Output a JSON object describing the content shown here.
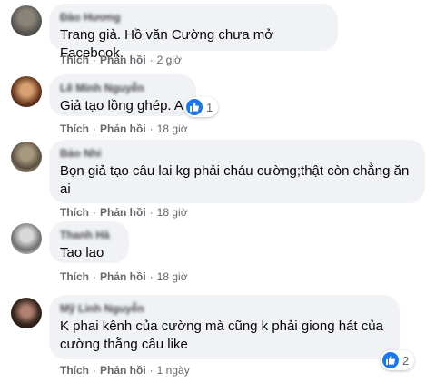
{
  "labels": {
    "like": "Thích",
    "reply": "Phản hồi",
    "separator": "·"
  },
  "comments": [
    {
      "author": "Đào Hương",
      "text": "Trang giả. Hồ văn Cường chưa mở Facebook.",
      "time": "2 giờ",
      "reactions": null
    },
    {
      "author": "Lê Minh Nguyễn",
      "text": "Giả tạo lồng ghép. A",
      "time": "18 giờ",
      "reactions": "1"
    },
    {
      "author": "Bảo Nhi",
      "text": "Bọn giả tạo câu lai kg phải cháu cường;thật còn chẳng ăn ai",
      "time": "18 giờ",
      "reactions": null
    },
    {
      "author": "Thanh Hà",
      "text": "Tao lao",
      "time": "18 giờ",
      "reactions": null
    },
    {
      "author": "Mỹ Linh Nguyễn",
      "text": "K phai kênh của cường mà cũng k phải giong hát của cường thằng câu like",
      "time": "1 ngày",
      "reactions": "2"
    }
  ],
  "colors": {
    "bubble": "#f0f2f5",
    "meta": "#65676b",
    "like_blue": "#1877f2"
  },
  "icons": {
    "reaction": "like-thumb-icon"
  }
}
